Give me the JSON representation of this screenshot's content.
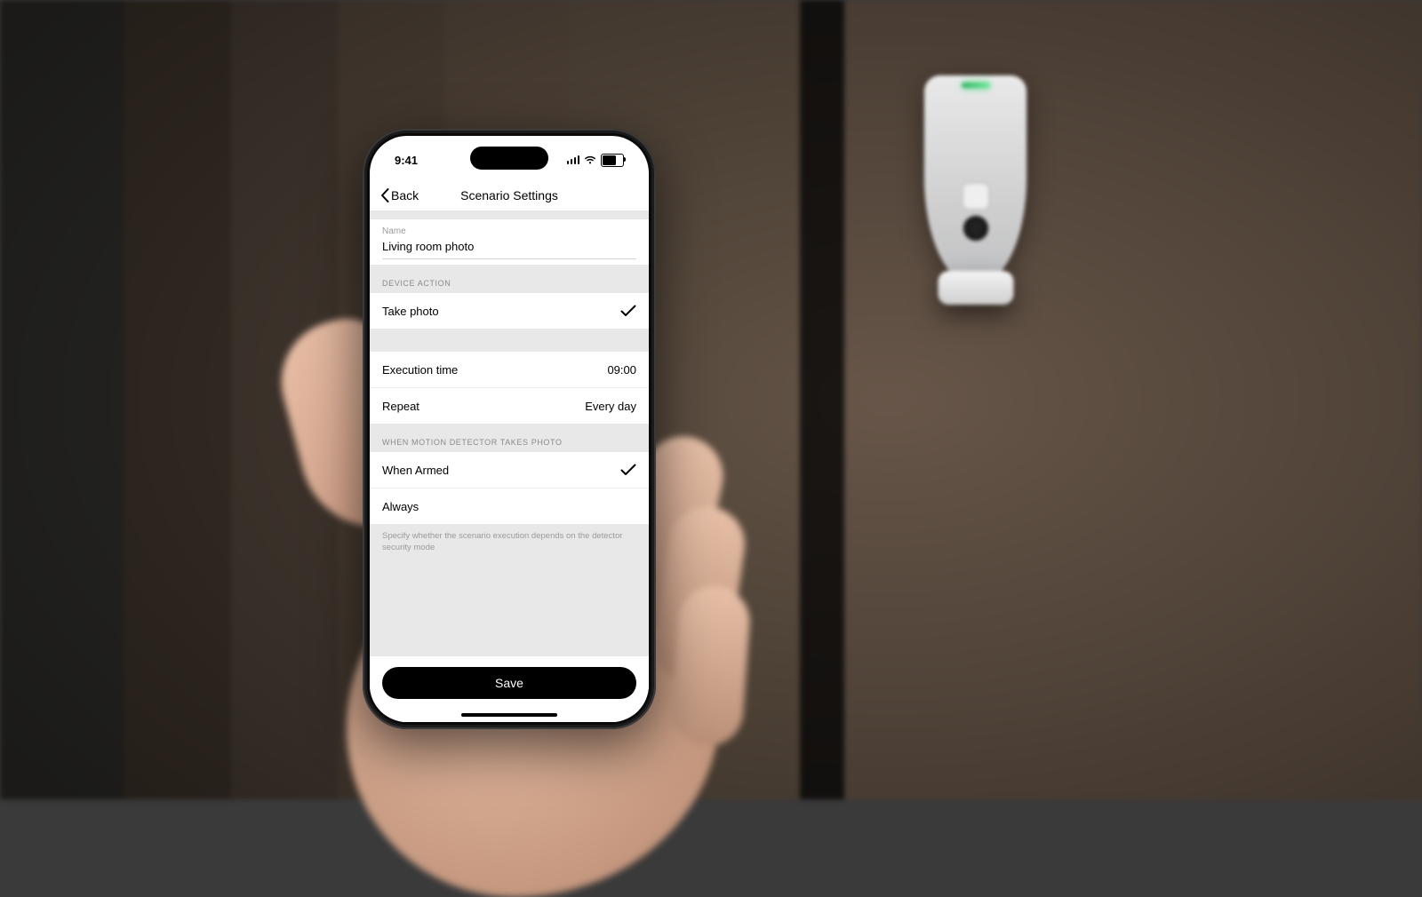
{
  "status": {
    "time": "9:41"
  },
  "nav": {
    "back_label": "Back",
    "title": "Scenario Settings"
  },
  "name_field": {
    "label": "Name",
    "value": "Living room photo"
  },
  "device_action": {
    "header": "DEVICE ACTION",
    "options": [
      {
        "label": "Take photo",
        "selected": true
      }
    ]
  },
  "schedule": {
    "execution_time": {
      "label": "Execution time",
      "value": "09:00"
    },
    "repeat": {
      "label": "Repeat",
      "value": "Every day"
    }
  },
  "photo_condition": {
    "header": "WHEN MOTION DETECTOR TAKES PHOTO",
    "options": [
      {
        "label": "When Armed",
        "selected": true
      },
      {
        "label": "Always",
        "selected": false
      }
    ],
    "footnote": "Specify whether the scenario execution depends on the detector security mode"
  },
  "save_button": "Save",
  "colors": {
    "bg_grouped": "#e8e8e8",
    "accent_save": "#000000",
    "detector_led": "#4ade80"
  }
}
